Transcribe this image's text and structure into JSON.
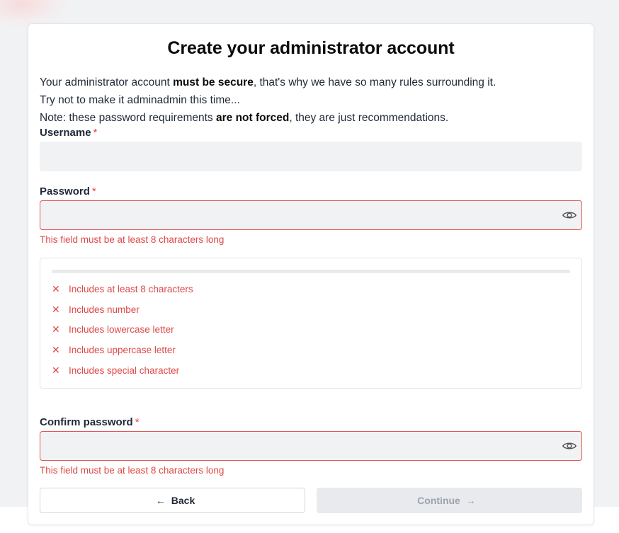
{
  "page": {
    "title": "Create your administrator account",
    "intro": [
      {
        "before": "Your administrator account ",
        "bold": "must be secure",
        "after": ", that's why we have so many rules surrounding it."
      },
      {
        "before": "Try not to make it adminadmin this time...",
        "bold": "",
        "after": ""
      },
      {
        "before": "Note: these password requirements ",
        "bold": "are not forced",
        "after": ", they are just recommendations."
      }
    ]
  },
  "form": {
    "username": {
      "label": "Username",
      "required_mark": "*",
      "value": ""
    },
    "password": {
      "label": "Password",
      "required_mark": "*",
      "value": "",
      "error": "This field must be at least 8 characters long",
      "toggle_icon": "eye-icon"
    },
    "requirements": [
      {
        "icon": "x-icon",
        "text": "Includes at least 8 characters"
      },
      {
        "icon": "x-icon",
        "text": "Includes number"
      },
      {
        "icon": "x-icon",
        "text": "Includes lowercase letter"
      },
      {
        "icon": "x-icon",
        "text": "Includes uppercase letter"
      },
      {
        "icon": "x-icon",
        "text": "Includes special character"
      }
    ],
    "strength": 0,
    "confirm_password": {
      "label": "Confirm password",
      "required_mark": "*",
      "value": "",
      "error": "This field must be at least 8 characters long",
      "toggle_icon": "eye-icon"
    }
  },
  "actions": {
    "back_label": "Back",
    "back_icon": "arrow-left-icon",
    "continue_label": "Continue",
    "continue_icon": "arrow-right-icon",
    "continue_disabled": true
  },
  "colors": {
    "error": "#e04848",
    "input_bg": "#f1f2f4",
    "page_bg": "#f1f2f4"
  }
}
